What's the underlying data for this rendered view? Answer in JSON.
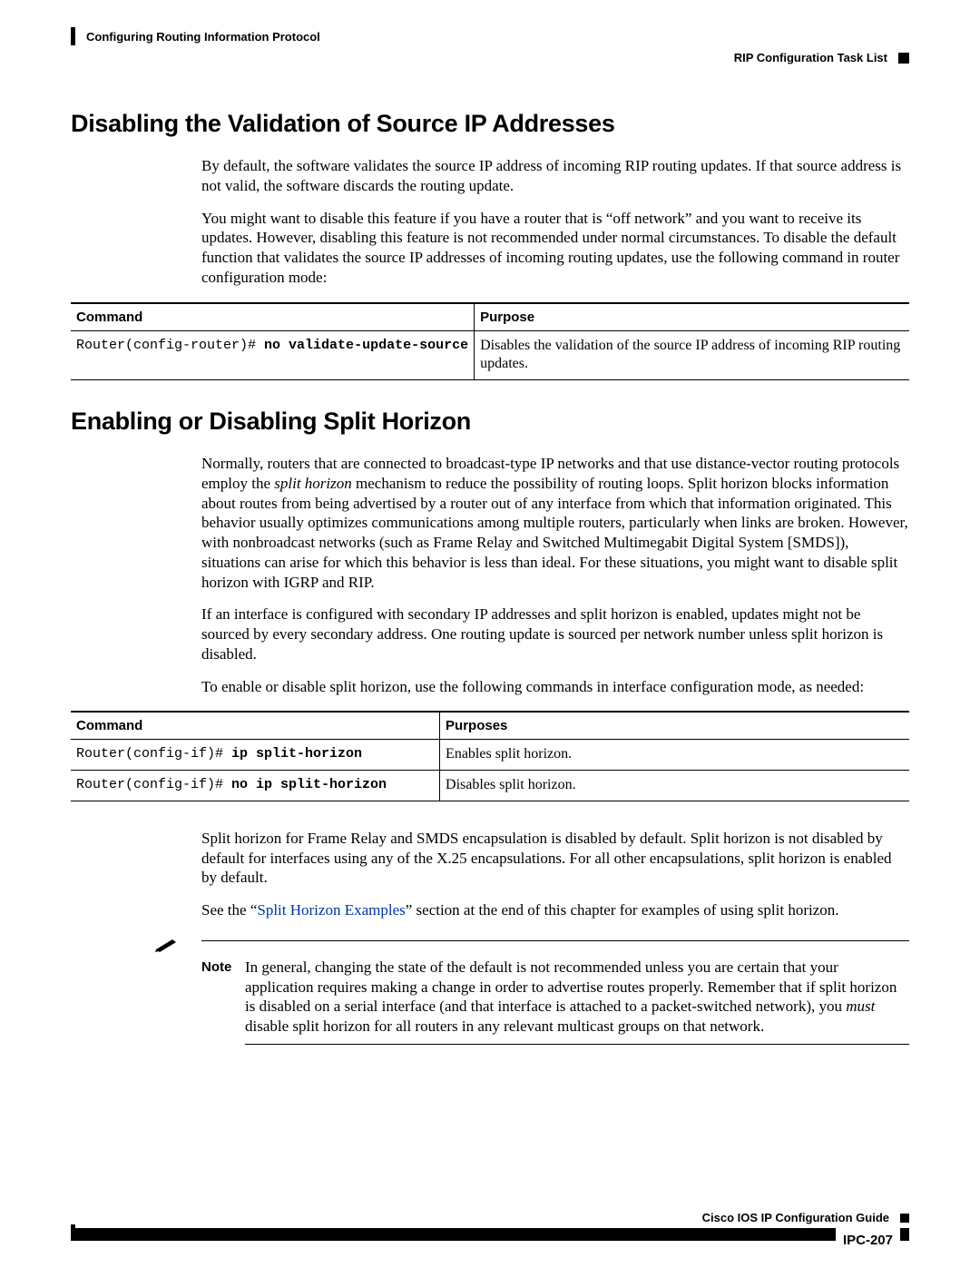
{
  "header": {
    "chapter": "Configuring Routing Information Protocol",
    "section": "RIP Configuration Task List"
  },
  "sec1": {
    "heading": "Disabling the Validation of Source IP Addresses",
    "p1": "By default, the software validates the source IP address of incoming RIP routing updates. If that source address is not valid, the software discards the routing update.",
    "p2": "You might want to disable this feature if you have a router that is “off network” and you want to receive its updates. However, disabling this feature is not recommended under normal circumstances. To disable the default function that validates the source IP addresses of incoming routing updates, use the following command in router configuration mode:"
  },
  "table1": {
    "h1": "Command",
    "h2": "Purpose",
    "r1": {
      "prompt": "Router(config-router)# ",
      "cmd": "no validate-update-source",
      "purpose": "Disables the validation of the source IP address of incoming RIP routing updates."
    }
  },
  "sec2": {
    "heading": "Enabling or Disabling Split Horizon",
    "p1a": "Normally, routers that are connected to broadcast-type IP networks and that use distance-vector routing protocols employ the ",
    "p1_em": "split horizon",
    "p1b": " mechanism to reduce the possibility of routing loops. Split horizon blocks information about routes from being advertised by a router out of any interface from which that information originated. This behavior usually optimizes communications among multiple routers, particularly when links are broken. However, with nonbroadcast networks (such as Frame Relay and Switched Multimegabit Digital System [SMDS]), situations can arise for which this behavior is less than ideal. For these situations, you might want to disable split horizon with IGRP and RIP.",
    "p2": "If an interface is configured with secondary IP addresses and split horizon is enabled, updates might not be sourced by every secondary address. One routing update is sourced per network number unless split horizon is disabled.",
    "p3": "To enable or disable split horizon, use the following commands in interface configuration mode, as needed:"
  },
  "table2": {
    "h1": "Command",
    "h2": "Purposes",
    "r1": {
      "prompt": "Router(config-if)# ",
      "cmd": "ip split-horizon",
      "purpose": "Enables split horizon."
    },
    "r2": {
      "prompt": "Router(config-if)# ",
      "cmd": "no ip split-horizon",
      "purpose": "Disables split horizon."
    }
  },
  "sec3": {
    "p1": "Split horizon for Frame Relay and SMDS encapsulation is disabled by default. Split horizon is not disabled by default for interfaces using any of the X.25 encapsulations. For all other encapsulations, split horizon is enabled by default.",
    "p2a": "See the “",
    "link": "Split Horizon Examples",
    "p2b": "” section at the end of this chapter for examples of using split horizon."
  },
  "note": {
    "label": "Note",
    "text_a": "In general, changing the state of the default is not recommended unless you are certain that your application requires making a change in order to advertise routes properly. Remember that if split horizon is disabled on a serial interface (and that interface is attached to a packet-switched network), you ",
    "em": "must",
    "text_b": " disable split horizon for all routers in any relevant multicast groups on that network."
  },
  "footer": {
    "guide": "Cisco IOS IP Configuration Guide",
    "page": "IPC-207"
  }
}
